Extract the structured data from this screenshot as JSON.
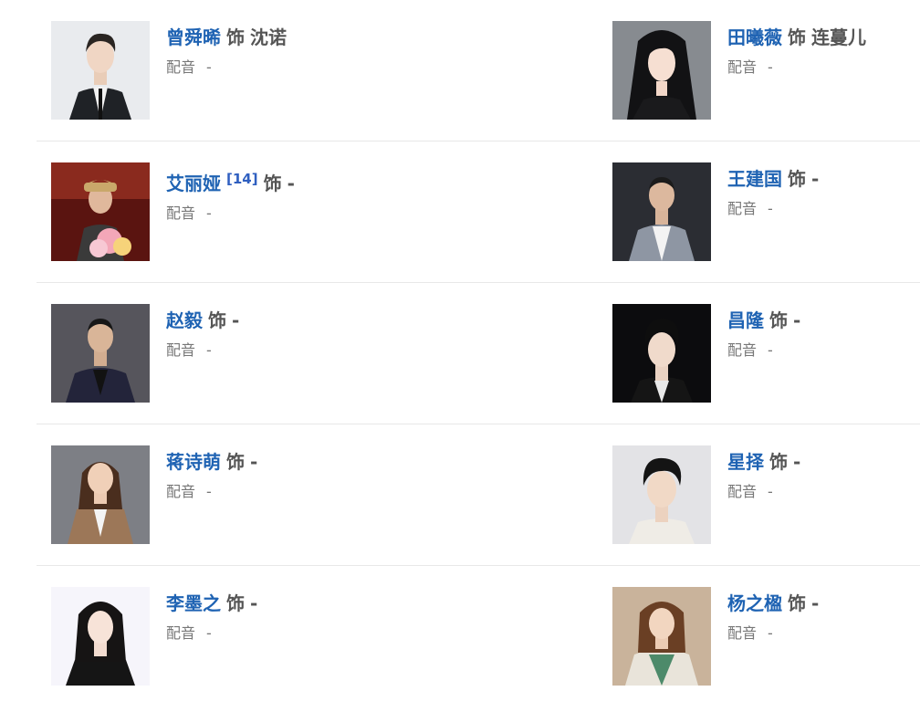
{
  "role_word": "饰",
  "voice_label": "配音",
  "cast": [
    {
      "actor": "曾舜晞",
      "ref": "",
      "role": "沈诺",
      "voice": "-"
    },
    {
      "actor": "田曦薇",
      "ref": "",
      "role": "连蔓儿",
      "voice": "-"
    },
    {
      "actor": "艾丽娅",
      "ref": "[14]",
      "role": "-",
      "voice": "-"
    },
    {
      "actor": "王建国",
      "ref": "",
      "role": "-",
      "voice": "-"
    },
    {
      "actor": "赵毅",
      "ref": "",
      "role": "-",
      "voice": "-"
    },
    {
      "actor": "昌隆",
      "ref": "",
      "role": "-",
      "voice": "-"
    },
    {
      "actor": "蒋诗萌",
      "ref": "",
      "role": "-",
      "voice": "-"
    },
    {
      "actor": "星择",
      "ref": "",
      "role": "-",
      "voice": "-"
    },
    {
      "actor": "李墨之",
      "ref": "",
      "role": "-",
      "voice": "-"
    },
    {
      "actor": "杨之楹",
      "ref": "",
      "role": "-",
      "voice": "-"
    }
  ],
  "colors": {
    "actor_link": "#1f63b3",
    "ref_link": "#2f5fc0",
    "role_text": "#555555",
    "voice_text": "#777777",
    "divider": "#e8e8e8"
  },
  "icons": {
    "photo": "actor-portrait-icon"
  }
}
